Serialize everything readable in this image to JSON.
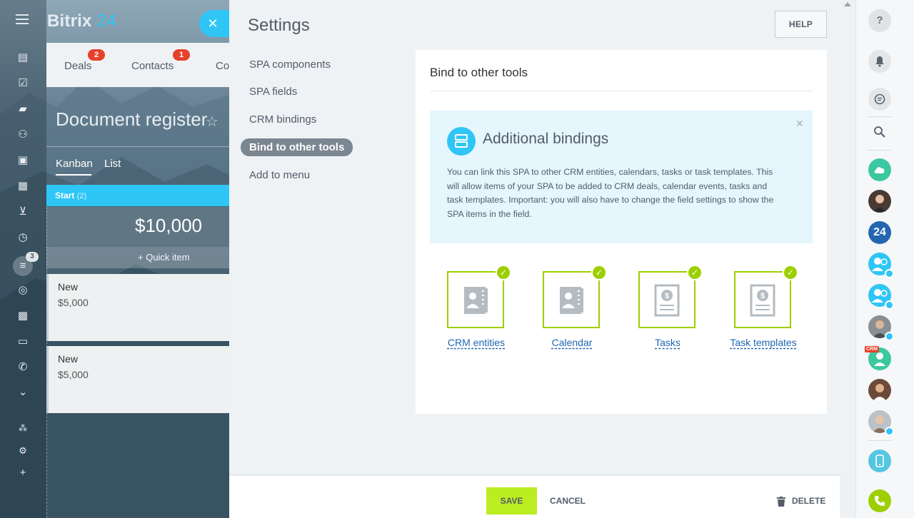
{
  "app": {
    "brand_name": "Bitrix",
    "brand_num": "24"
  },
  "background": {
    "top_tabs": [
      {
        "label": "Deals",
        "badge": "2"
      },
      {
        "label": "Contacts",
        "badge": "1"
      },
      {
        "label": "Co",
        "badge": ""
      }
    ],
    "page_title": "Document register",
    "view_tabs": [
      "Kanban",
      "List"
    ],
    "stage": {
      "name": "Start",
      "count": "(2)",
      "sum": "$10,000",
      "quick_item": "+ Quick item"
    },
    "cards": [
      {
        "name": "New",
        "price": "$5,000"
      },
      {
        "name": "New",
        "price": "$5,000"
      }
    ],
    "nav_badge": "3"
  },
  "settings": {
    "title": "Settings",
    "help_label": "HELP",
    "menu": [
      {
        "label": "SPA components",
        "active": false
      },
      {
        "label": "SPA fields",
        "active": false
      },
      {
        "label": "CRM bindings",
        "active": false
      },
      {
        "label": "Bind to other tools",
        "active": true
      },
      {
        "label": "Add to menu",
        "active": false
      }
    ],
    "card": {
      "title": "Bind to other tools",
      "info": {
        "heading": "Additional bindings",
        "text": "You can link this SPA to other CRM entities, calendars, tasks or task templates. This will allow items of your SPA to be added to CRM deals, calendar events, tasks and task templates. Important: you will also have to change the field settings to show the SPA items in the field."
      },
      "tools": [
        {
          "label": "CRM entities",
          "icon": "contact-card-icon",
          "checked": true
        },
        {
          "label": "Calendar",
          "icon": "contact-card-icon",
          "checked": true
        },
        {
          "label": "Tasks",
          "icon": "dollar-document-icon",
          "checked": true
        },
        {
          "label": "Task templates",
          "icon": "dollar-document-icon",
          "checked": true
        }
      ]
    }
  },
  "footer": {
    "save_label": "SAVE",
    "cancel_label": "CANCEL",
    "delete_label": "DELETE"
  },
  "right_rail": {
    "help_icon": "?",
    "bitrix_badge": "24",
    "crm_tag": "CRM"
  },
  "colors": {
    "accent_blue": "#2fc6f6",
    "accent_green": "#9dcf00",
    "save_green": "#bbed21",
    "link_blue": "#2067b0",
    "badge_red": "#e6412a"
  }
}
